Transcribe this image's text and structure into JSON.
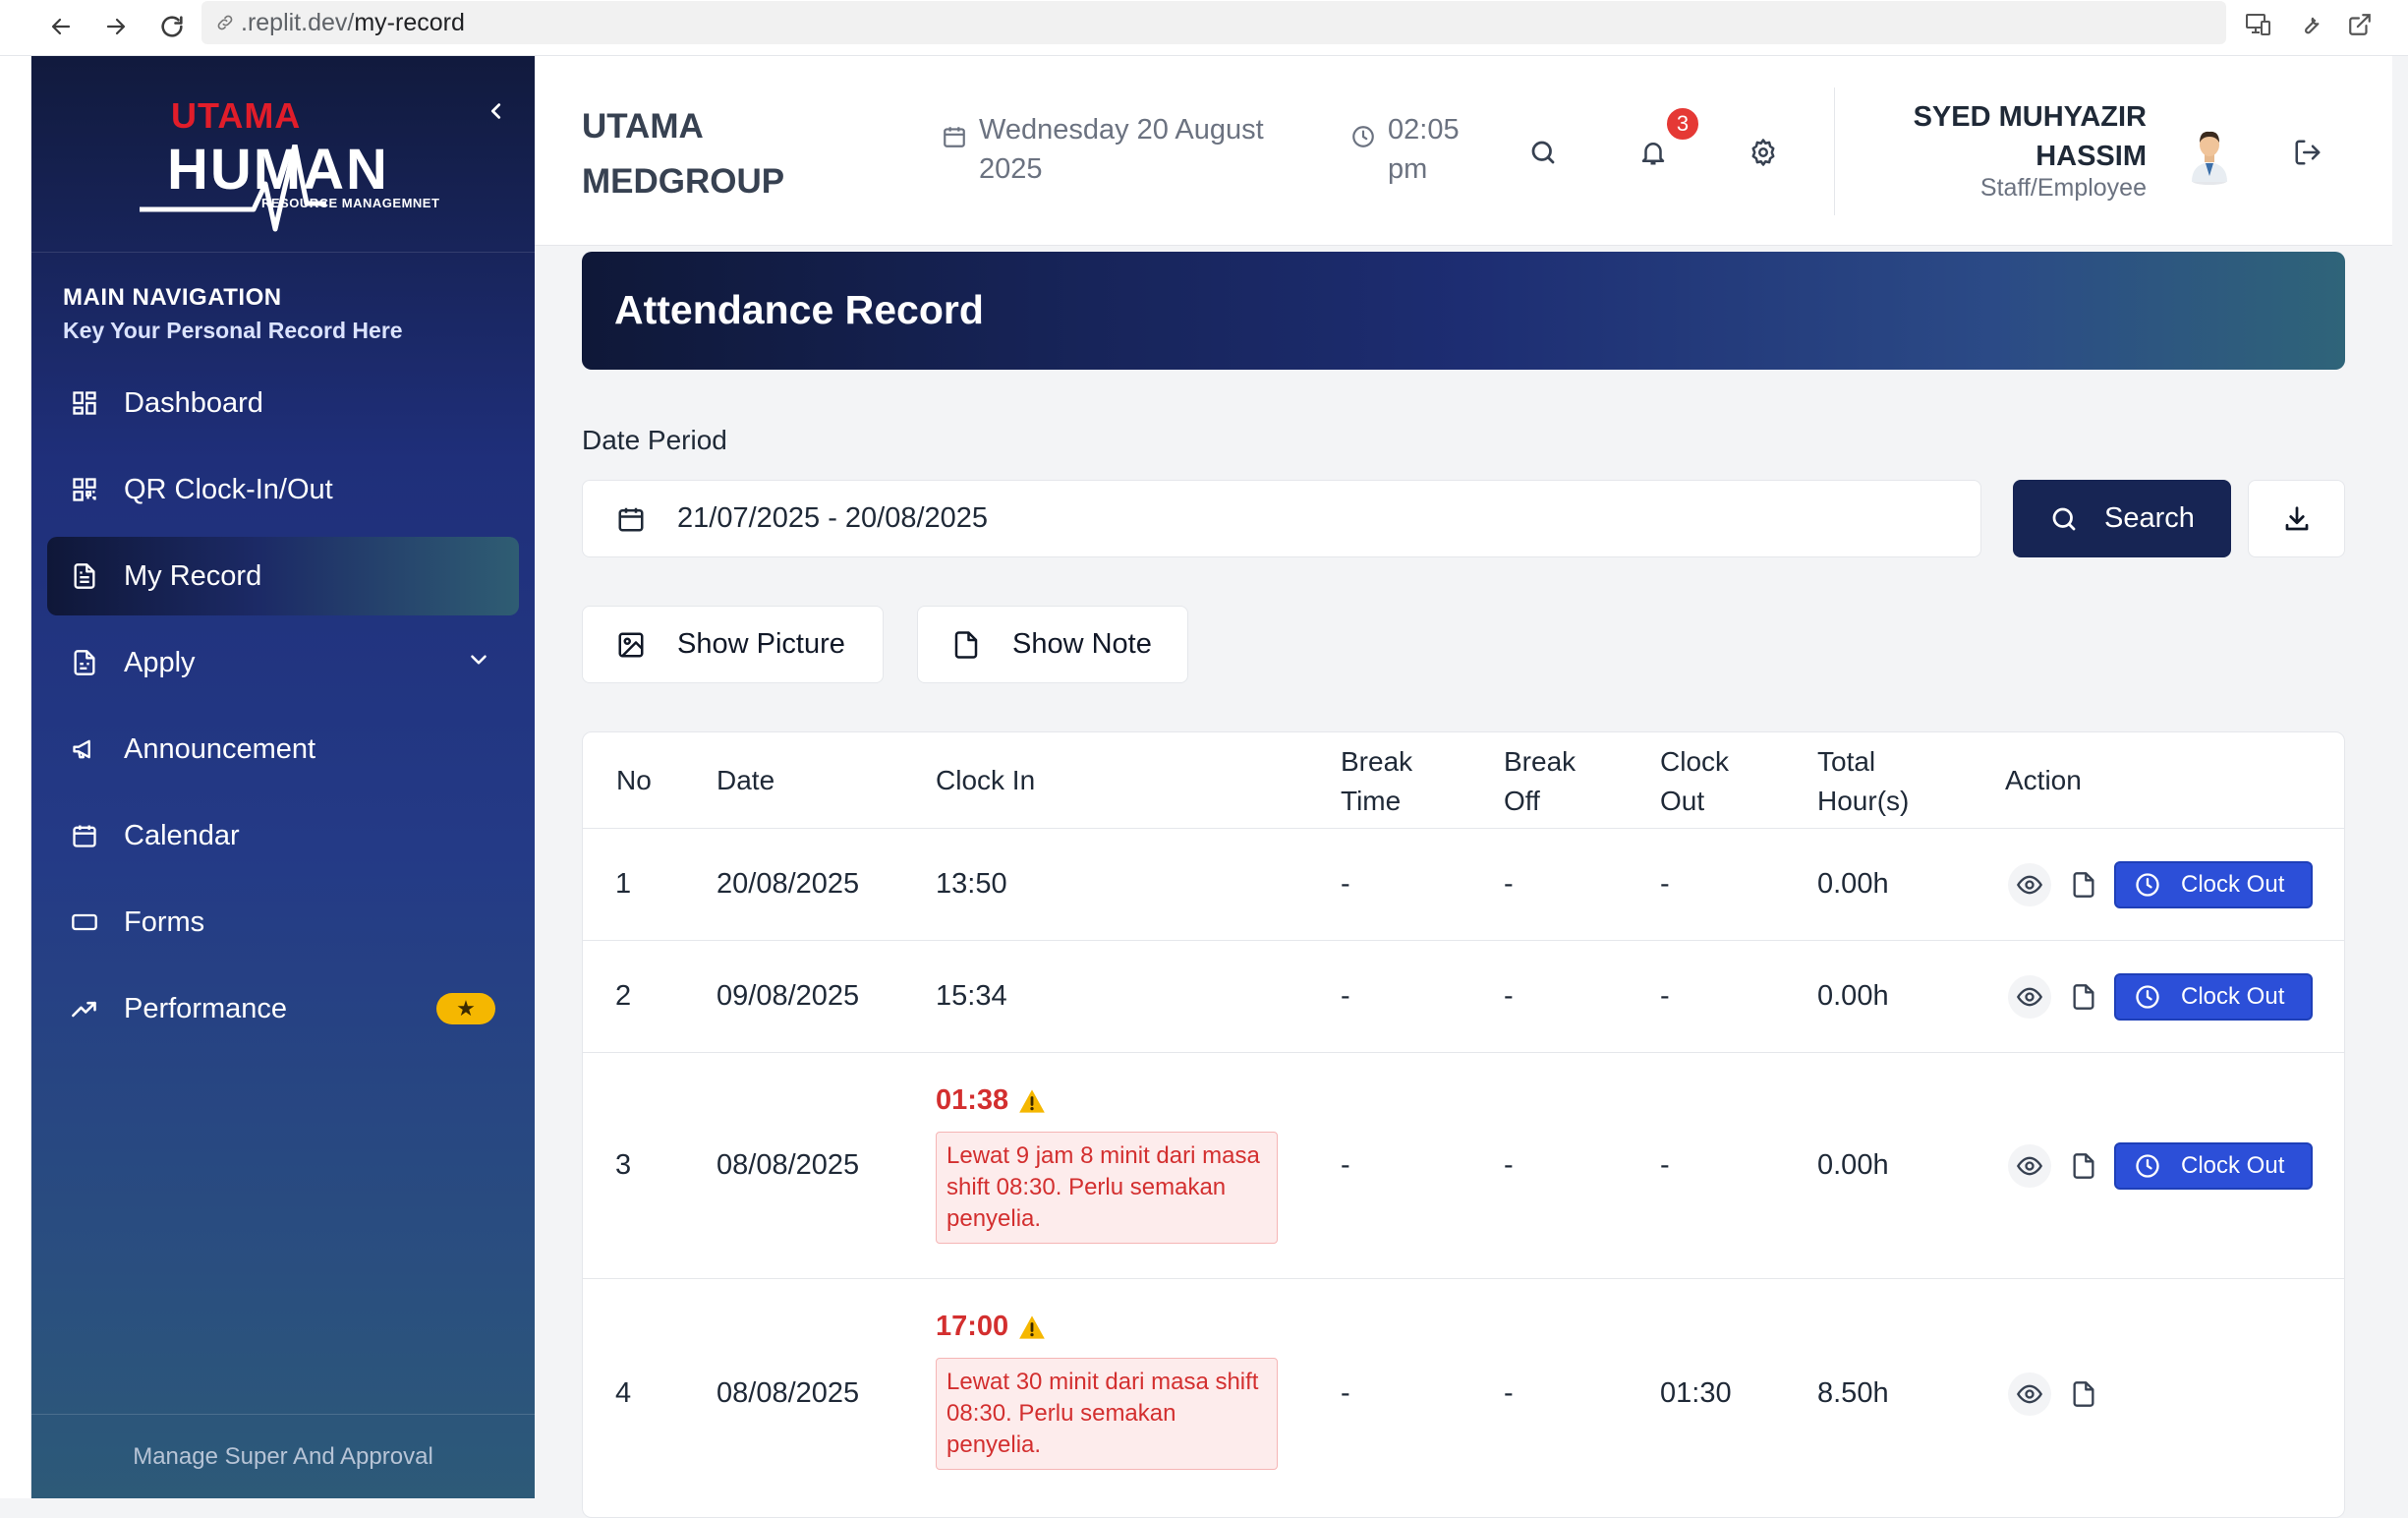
{
  "browser": {
    "url_prefix": ".replit.dev/",
    "url_path": "my-record"
  },
  "sidebar": {
    "logo_top": "UTAMA",
    "logo_main": "HUMAN",
    "logo_sub": "RESOURCE MANAGEMNET",
    "nav_title": "MAIN NAVIGATION",
    "nav_subtitle": "Key Your Personal Record Here",
    "items": [
      {
        "label": "Dashboard",
        "icon": "dashboard-icon"
      },
      {
        "label": "QR Clock-In/Out",
        "icon": "qr-code-icon"
      },
      {
        "label": "My Record",
        "icon": "document-icon",
        "active": true
      },
      {
        "label": "Apply",
        "icon": "form-icon",
        "has_submenu": true
      },
      {
        "label": "Announcement",
        "icon": "megaphone-icon"
      },
      {
        "label": "Calendar",
        "icon": "calendar-icon"
      },
      {
        "label": "Forms",
        "icon": "keyboard-icon"
      },
      {
        "label": "Performance",
        "icon": "trending-up-icon",
        "badge": "★"
      }
    ],
    "footer": "Manage Super And Approval"
  },
  "header": {
    "company": "UTAMA MEDGROUP",
    "date": "Wednesday 20 August 2025",
    "time": "02:05 pm",
    "notification_count": "3",
    "user_name": "SYED MUHYAZIR HASSIM",
    "user_role": "Staff/Employee"
  },
  "page": {
    "title": "Attendance Record",
    "date_period_label": "Date Period",
    "date_range": "21/07/2025 - 20/08/2025",
    "search_label": "Search",
    "show_picture_label": "Show Picture",
    "show_note_label": "Show Note"
  },
  "table": {
    "headers": {
      "no": "No",
      "date": "Date",
      "clock_in": "Clock In",
      "break_time": "Break Time",
      "break_off": "Break Off",
      "clock_out": "Clock Out",
      "total_hours": "Total Hour(s)",
      "action": "Action"
    },
    "clock_out_label": "Clock Out",
    "rows": [
      {
        "no": "1",
        "date": "20/08/2025",
        "clock_in": "13:50",
        "break_time": "-",
        "break_off": "-",
        "clock_out": "-",
        "total": "0.00h"
      },
      {
        "no": "2",
        "date": "09/08/2025",
        "clock_in": "15:34",
        "break_time": "-",
        "break_off": "-",
        "clock_out": "-",
        "total": "0.00h"
      },
      {
        "no": "3",
        "date": "08/08/2025",
        "clock_in": "01:38",
        "late_note": "Lewat 9 jam 8 minit dari masa shift 08:30. Perlu semakan penyelia.",
        "break_time": "-",
        "break_off": "-",
        "clock_out": "-",
        "total": "0.00h"
      },
      {
        "no": "4",
        "date": "08/08/2025",
        "clock_in": "17:00",
        "late_note": "Lewat 30 minit dari masa shift 08:30. Perlu semakan penyelia.",
        "break_time": "-",
        "break_off": "-",
        "clock_out": "01:30",
        "total": "8.50h"
      }
    ]
  },
  "colors": {
    "accent": "#172554",
    "clock_out_button": "#2c4fd8",
    "late_text": "#d32f2f",
    "badge": "#e53935",
    "star_badge": "#f5b700"
  }
}
